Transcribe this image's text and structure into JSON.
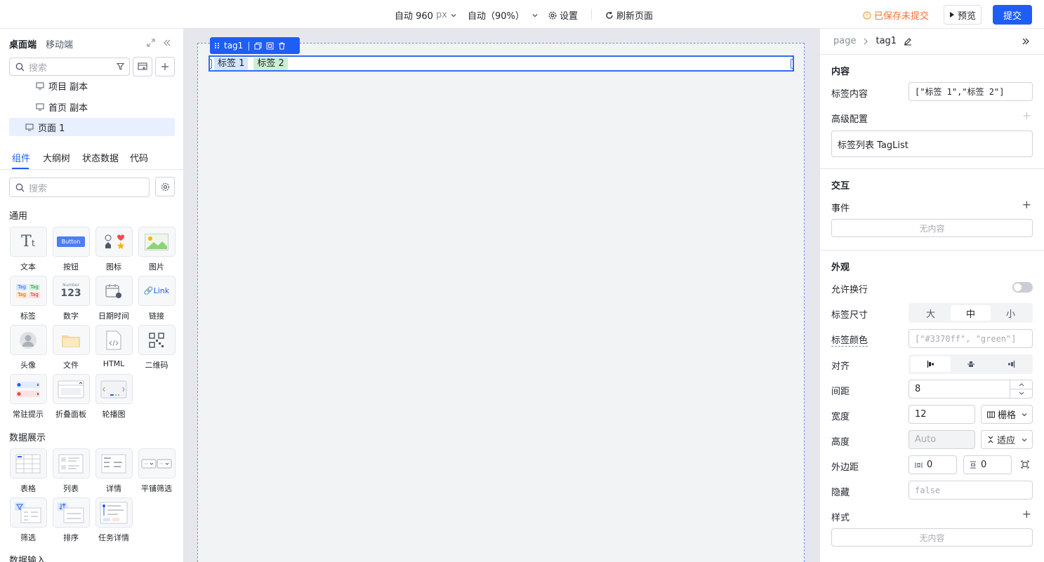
{
  "topbar": {
    "width_label": "自动 960",
    "width_unit": "px",
    "zoom_label": "自动（90%）",
    "settings_label": "设置",
    "refresh_label": "刷新页面",
    "save_status": "已保存未提交",
    "preview_label": "预览",
    "submit_label": "提交"
  },
  "left": {
    "tabs_top": {
      "desktop": "桌面端",
      "mobile": "移动端"
    },
    "search_placeholder": "搜索",
    "pages": [
      {
        "label": "项目 副本"
      },
      {
        "label": "首页 副本"
      },
      {
        "label": "页面 1"
      }
    ],
    "tabs": [
      "组件",
      "大纲树",
      "状态数据",
      "代码"
    ],
    "comp_search_placeholder": "搜索",
    "section_general": "通用",
    "general": [
      "文本",
      "按钮",
      "图标",
      "图片",
      "标签",
      "数字",
      "日期时间",
      "链接",
      "头像",
      "文件",
      "HTML",
      "二维码",
      "常驻提示",
      "折叠面板",
      "轮播图"
    ],
    "section_data": "数据展示",
    "data": [
      "表格",
      "列表",
      "详情",
      "平铺筛选",
      "筛选",
      "排序",
      "任务详情"
    ],
    "section_input": "数据输入",
    "thumb": {
      "button": "Button",
      "number_small": "Number",
      "number_big": "123",
      "link": "Link",
      "tag": "Tag"
    }
  },
  "canvas": {
    "selected_name": "tag1",
    "tags": [
      "标签 1",
      "标签 2"
    ]
  },
  "right": {
    "breadcrumb_page": "page",
    "breadcrumb_current": "tag1",
    "content_title": "内容",
    "tag_content_label": "标签内容",
    "tag_content_value": "[\"标签 1\",\"标签 2\"]",
    "advanced_label": "高级配置",
    "advanced_value": "标签列表 TagList",
    "interaction_title": "交互",
    "events_label": "事件",
    "empty_text": "无内容",
    "appearance_title": "外观",
    "wrap_label": "允许换行",
    "size_label": "标签尺寸",
    "size_options": [
      "大",
      "中",
      "小"
    ],
    "size_selected": "中",
    "color_label": "标签颜色",
    "color_placeholder": "[\"#3370ff\", \"green\"]",
    "align_label": "对齐",
    "gap_label": "间距",
    "gap_value": "8",
    "width_label": "宽度",
    "width_value": "12",
    "width_mode": "栅格",
    "height_label": "高度",
    "height_placeholder": "Auto",
    "height_mode": "适应",
    "margin_label": "外边距",
    "margin_x": "0",
    "margin_y": "0",
    "hidden_label": "隐藏",
    "hidden_placeholder": "false",
    "style_label": "样式",
    "style_empty": "无内容"
  },
  "colors": {
    "accent": "#1f5ef5",
    "tag1_bg": "#d6e4ff",
    "tag2_bg": "#cdeed3",
    "warning": "#f7a530"
  }
}
